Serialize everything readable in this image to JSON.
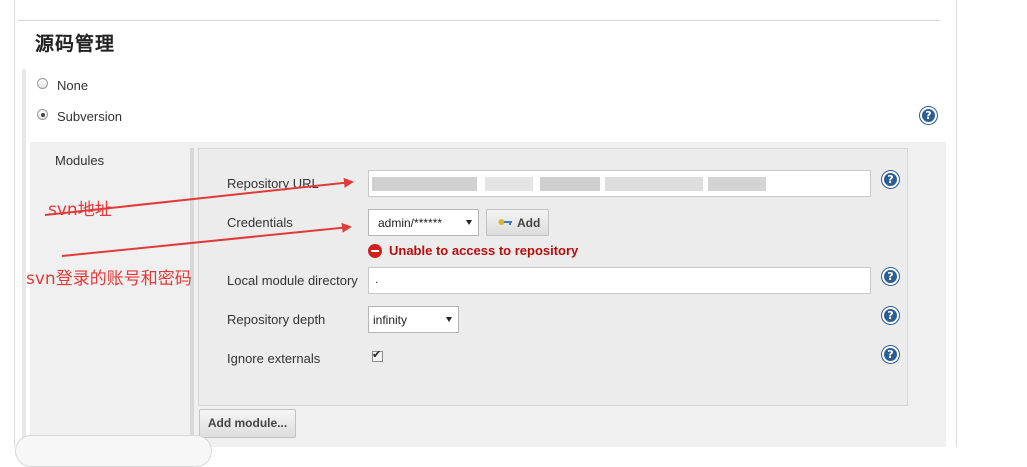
{
  "section": {
    "title": "源码管理"
  },
  "scm_options": [
    {
      "label": "None",
      "selected": false
    },
    {
      "label": "Subversion",
      "selected": true
    }
  ],
  "modules": {
    "label": "Modules",
    "repository_url": {
      "label": "Repository URL",
      "value": ""
    },
    "credentials": {
      "label": "Credentials",
      "selected": "admin/******",
      "add_label": "Add"
    },
    "error_message": "Unable to access to repository",
    "local_module_directory": {
      "label": "Local module directory",
      "value": "."
    },
    "repository_depth": {
      "label": "Repository depth",
      "selected": "infinity"
    },
    "ignore_externals": {
      "label": "Ignore externals",
      "checked": true
    },
    "add_module_label": "Add module..."
  },
  "help_icon_text": "?",
  "annotations": {
    "svn_address": "svn地址",
    "svn_login": "svn登录的账号和密码"
  },
  "colors": {
    "annotation_red": "#e23a3a",
    "error_red": "#b80d0d",
    "help_blue": "#2c5d93",
    "panel_gray": "#f0f0f0"
  }
}
